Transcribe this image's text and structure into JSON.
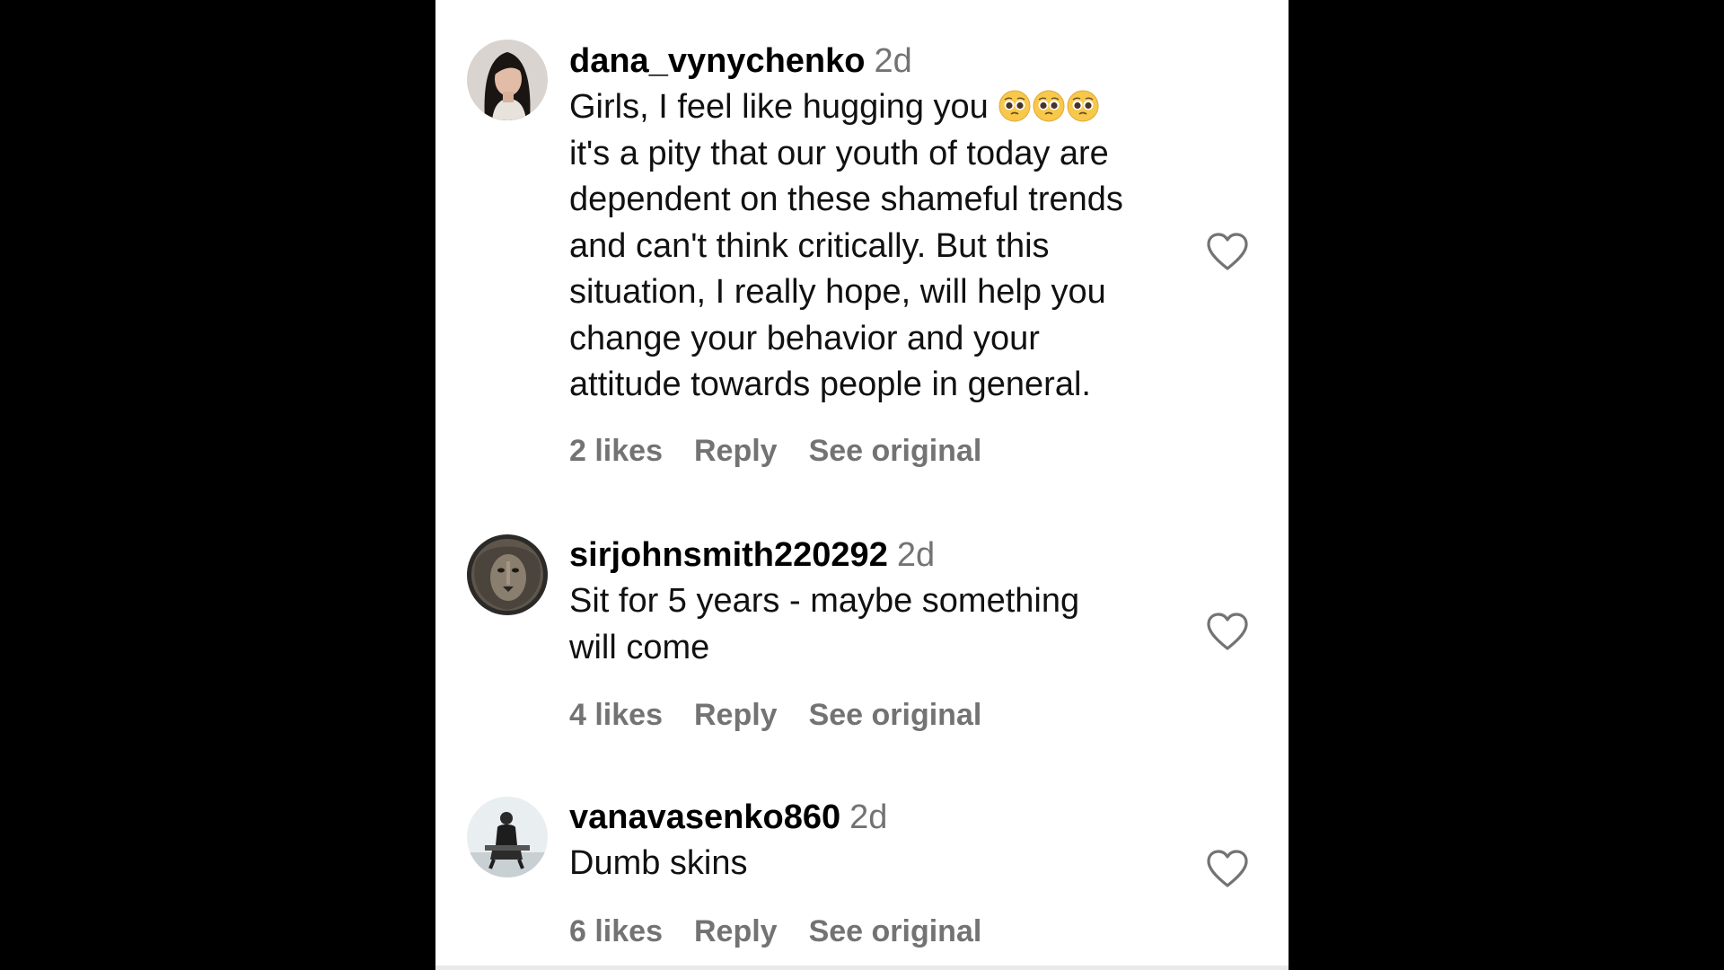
{
  "comments": [
    {
      "username": "dana_vynychenko",
      "time": "2d",
      "text_first": "Girls, I feel like hugging you ",
      "emoji": [
        "pleading-face",
        "pleading-face",
        "pleading-face"
      ],
      "text_rest": "it's a pity that our youth of today are\ndependent on these shameful trends\nand can't think critically. But this\nsituation, I really hope, will help you\nchange your behavior and your\nattitude towards people in general.",
      "likes": "2 likes",
      "reply": "Reply",
      "see_original": "See original",
      "avatar": "woman-portrait"
    },
    {
      "username": "sirjohnsmith220292",
      "time": "2d",
      "text": "Sit for 5 years - maybe something\nwill come",
      "likes": "4 likes",
      "reply": "Reply",
      "see_original": "See original",
      "avatar": "lion-portrait"
    },
    {
      "username": "vanavasenko860",
      "time": "2d",
      "text": "Dumb skins",
      "likes": "6 likes",
      "reply": "Reply",
      "see_original": "See original",
      "avatar": "man-sitting-portrait"
    }
  ],
  "colors": {
    "background": "#000000",
    "panel": "#ffffff",
    "text": "#000000",
    "secondary": "#737373"
  },
  "icons": {
    "like": "heart-outline-icon"
  }
}
